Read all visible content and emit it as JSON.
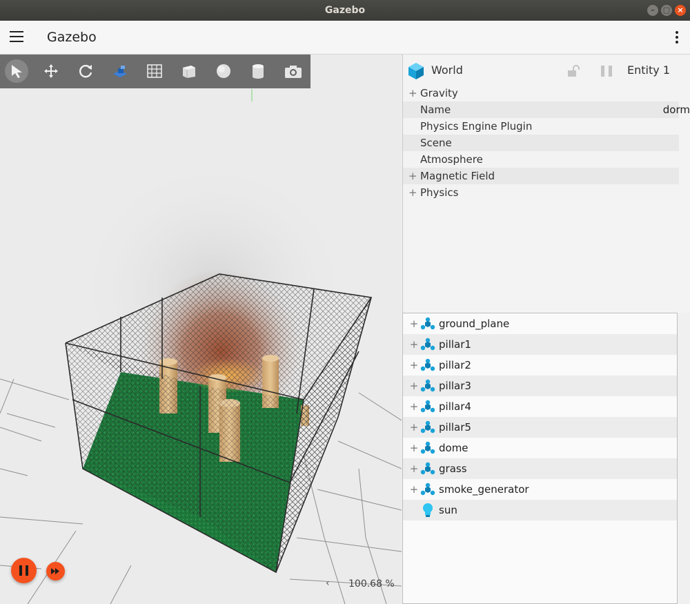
{
  "window": {
    "title": "Gazebo"
  },
  "app": {
    "title": "Gazebo"
  },
  "toolbar": {
    "tools": [
      "select-icon",
      "translate-icon",
      "rotate-icon",
      "transform-control-icon",
      "grid-config-icon",
      "box-shape-icon",
      "sphere-shape-icon",
      "cylinder-shape-icon",
      "screenshot-icon"
    ]
  },
  "viewport": {
    "zoom": "100.68 %",
    "zoom_arrow": "‹"
  },
  "inspector": {
    "entity_type": "World",
    "entity_label": "Entity 1",
    "properties": [
      {
        "expand": "+",
        "label": "Gravity",
        "value": ""
      },
      {
        "expand": "",
        "label": "Name",
        "value": "dorm"
      },
      {
        "expand": "",
        "label": "Physics Engine Plugin",
        "value": ""
      },
      {
        "expand": "",
        "label": "Scene",
        "value": ""
      },
      {
        "expand": "",
        "label": "Atmosphere",
        "value": ""
      },
      {
        "expand": "+",
        "label": "Magnetic Field",
        "value": ""
      },
      {
        "expand": "+",
        "label": "Physics",
        "value": ""
      }
    ]
  },
  "entity_tree": {
    "items": [
      {
        "expand": "+",
        "label": "ground_plane",
        "icon": "model-icon"
      },
      {
        "expand": "+",
        "label": "pillar1",
        "icon": "model-icon"
      },
      {
        "expand": "+",
        "label": "pillar2",
        "icon": "model-icon"
      },
      {
        "expand": "+",
        "label": "pillar3",
        "icon": "model-icon"
      },
      {
        "expand": "+",
        "label": "pillar4",
        "icon": "model-icon"
      },
      {
        "expand": "+",
        "label": "pillar5",
        "icon": "model-icon"
      },
      {
        "expand": "+",
        "label": "dome",
        "icon": "model-icon"
      },
      {
        "expand": "+",
        "label": "grass",
        "icon": "model-icon"
      },
      {
        "expand": "+",
        "label": "smoke_generator",
        "icon": "model-icon"
      },
      {
        "expand": "",
        "label": "sun",
        "icon": "light-icon"
      }
    ]
  },
  "colors": {
    "accent": "#f4511e",
    "toolbar": "#626262",
    "entity_icon": "#1aa3d9",
    "grass": "#1f7a3a",
    "pillar": "#d4ad7a"
  }
}
